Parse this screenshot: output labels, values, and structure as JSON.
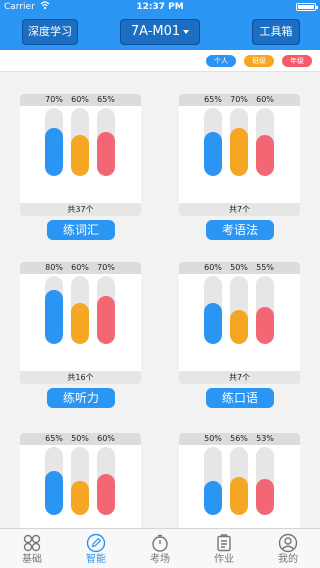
{
  "status_bar": {
    "carrier": "Carrier",
    "time": "12:37 PM"
  },
  "nav": {
    "left_button": "深度学习",
    "title": "7A-M01",
    "right_button": "工具箱"
  },
  "legend": {
    "personal": "个人",
    "class": "班级",
    "grade": "年级"
  },
  "colors": {
    "personal": "#2b95f3",
    "class": "#f5a623",
    "grade": "#f26773",
    "primary": "#2b95f3"
  },
  "cards": [
    {
      "values": [
        70,
        60,
        65
      ],
      "labels": [
        "70%",
        "60%",
        "65%"
      ],
      "count": "共37个",
      "button": "练词汇"
    },
    {
      "values": [
        65,
        70,
        60
      ],
      "labels": [
        "65%",
        "70%",
        "60%"
      ],
      "count": "共7个",
      "button": "考语法"
    },
    {
      "values": [
        80,
        60,
        70
      ],
      "labels": [
        "80%",
        "60%",
        "70%"
      ],
      "count": "共16个",
      "button": "练听力"
    },
    {
      "values": [
        60,
        50,
        55
      ],
      "labels": [
        "60%",
        "50%",
        "55%"
      ],
      "count": "共7个",
      "button": "练口语"
    },
    {
      "values": [
        65,
        50,
        60
      ],
      "labels": [
        "65%",
        "50%",
        "60%"
      ],
      "count": "",
      "button": ""
    },
    {
      "values": [
        50,
        56,
        53
      ],
      "labels": [
        "50%",
        "56%",
        "53%"
      ],
      "count": "",
      "button": ""
    }
  ],
  "tabs": [
    {
      "label": "基础",
      "icon": "grid-icon"
    },
    {
      "label": "智能",
      "icon": "pencil-icon"
    },
    {
      "label": "考场",
      "icon": "timer-icon"
    },
    {
      "label": "作业",
      "icon": "clipboard-icon"
    },
    {
      "label": "我的",
      "icon": "user-icon"
    }
  ]
}
